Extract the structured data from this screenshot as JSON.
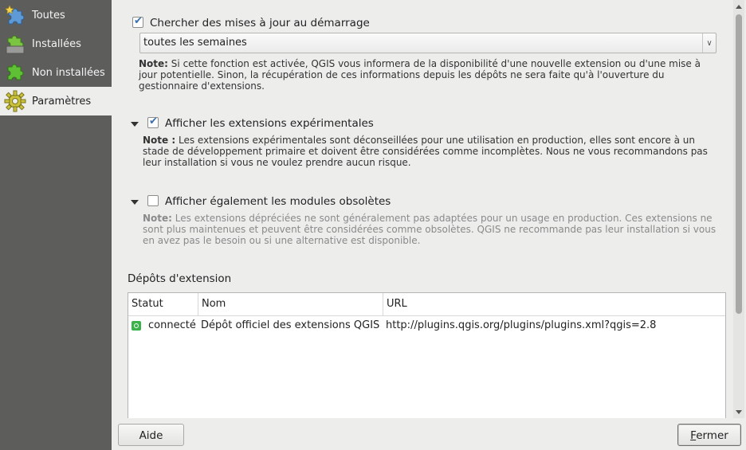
{
  "sidebar": {
    "items": [
      {
        "label": "Toutes",
        "icon": "puzzle-star-icon"
      },
      {
        "label": "Installées",
        "icon": "puzzle-installed-icon"
      },
      {
        "label": "Non installées",
        "icon": "puzzle-green-icon"
      },
      {
        "label": "Paramètres",
        "icon": "gear-icon"
      }
    ],
    "active": "Paramètres"
  },
  "updates": {
    "check_label": "Chercher des mises à jour au démarrage",
    "checked": true,
    "frequency": "toutes les semaines",
    "note_prefix": "Note:",
    "note_text": "Si cette fonction est activée, QGIS vous informera de la disponibilité d'une nouvelle extension ou d'une mise à jour potentielle. Sinon, la récupération de ces informations depuis les dépôts ne sera faite qu'à l'ouverture du gestionnaire d'extensions."
  },
  "experimental": {
    "check_label": "Afficher les extensions expérimentales",
    "checked": true,
    "note_prefix": "Note :",
    "note_text": "Les extensions expérimentales sont déconseillées pour une utilisation en production, elles sont encore à un stade de développement primaire et doivent être considérées comme incomplètes. Nous ne vous recommandons pas leur installation si vous ne voulez prendre aucun risque."
  },
  "deprecated": {
    "check_label": "Afficher également les modules obsolètes",
    "checked": false,
    "note_prefix": "Note:",
    "note_text": "Les extensions dépréciées ne sont généralement pas adaptées pour un usage en production. Ces extensions ne sont plus maintenues et peuvent être considérées comme obsolètes. QGIS ne recommande pas leur installation si vous en avez pas le besoin ou si une alternative est disponible."
  },
  "repos": {
    "title": "Dépôts d'extension",
    "columns": [
      "Statut",
      "Nom",
      "URL"
    ],
    "rows": [
      {
        "status": "connecté",
        "name": "Dépôt officiel des extensions QGIS",
        "url": "http://plugins.qgis.org/plugins/plugins.xml?qgis=2.8"
      }
    ]
  },
  "buttons": {
    "help": "Aide",
    "close": "Fermer"
  },
  "colors": {
    "sidebar_bg": "#5d5d5b",
    "status_ok": "#3bb24a",
    "check_accent": "#3a6fb0"
  }
}
